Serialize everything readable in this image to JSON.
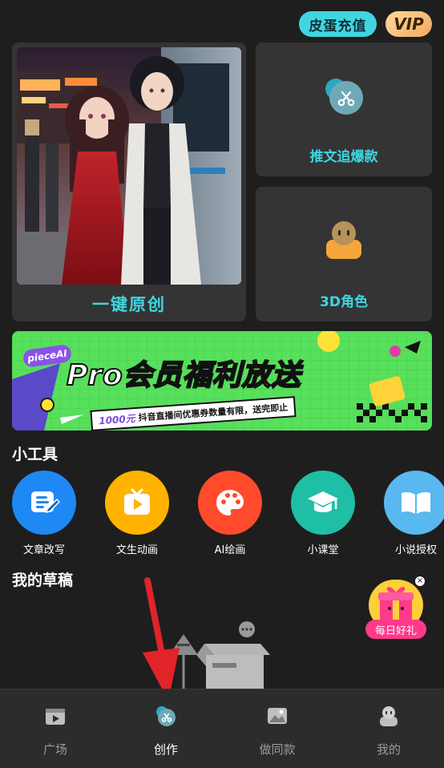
{
  "header": {
    "recharge_label": "皮蛋充值",
    "vip_label": "VIP"
  },
  "features": {
    "main_label": "一键原创",
    "top_right_label": "推文追爆款",
    "bottom_right_label": "3D角色"
  },
  "banner": {
    "brand": "pieceAI",
    "title": "Pro会员福利放送",
    "subtitle_highlight": "1000元",
    "subtitle": "抖音直播间优惠券数量有限，送完即止"
  },
  "tools": {
    "title": "小工具",
    "items": [
      {
        "label": "文章改写",
        "icon": "edit-document-icon",
        "color": "#1e88f5"
      },
      {
        "label": "文生动画",
        "icon": "tv-play-icon",
        "color": "#ffb300"
      },
      {
        "label": "AI绘画",
        "icon": "palette-icon",
        "color": "#ff4b2b"
      },
      {
        "label": "小课堂",
        "icon": "graduation-cap-icon",
        "color": "#1fbfa5"
      },
      {
        "label": "小说授权",
        "icon": "open-book-icon",
        "color": "#5ab8f0"
      }
    ]
  },
  "drafts": {
    "title": "我的草稿"
  },
  "gift": {
    "label": "每日好礼"
  },
  "nav": {
    "items": [
      {
        "label": "广场",
        "icon": "film-icon"
      },
      {
        "label": "创作",
        "icon": "scissors-icon"
      },
      {
        "label": "做同款",
        "icon": "image-icon"
      },
      {
        "label": "我的",
        "icon": "user-icon"
      }
    ],
    "active_index": 1
  },
  "colors": {
    "accent": "#3fd6e0",
    "background": "#1e1e1e",
    "card": "#343434",
    "banner_green": "#57e05c"
  }
}
